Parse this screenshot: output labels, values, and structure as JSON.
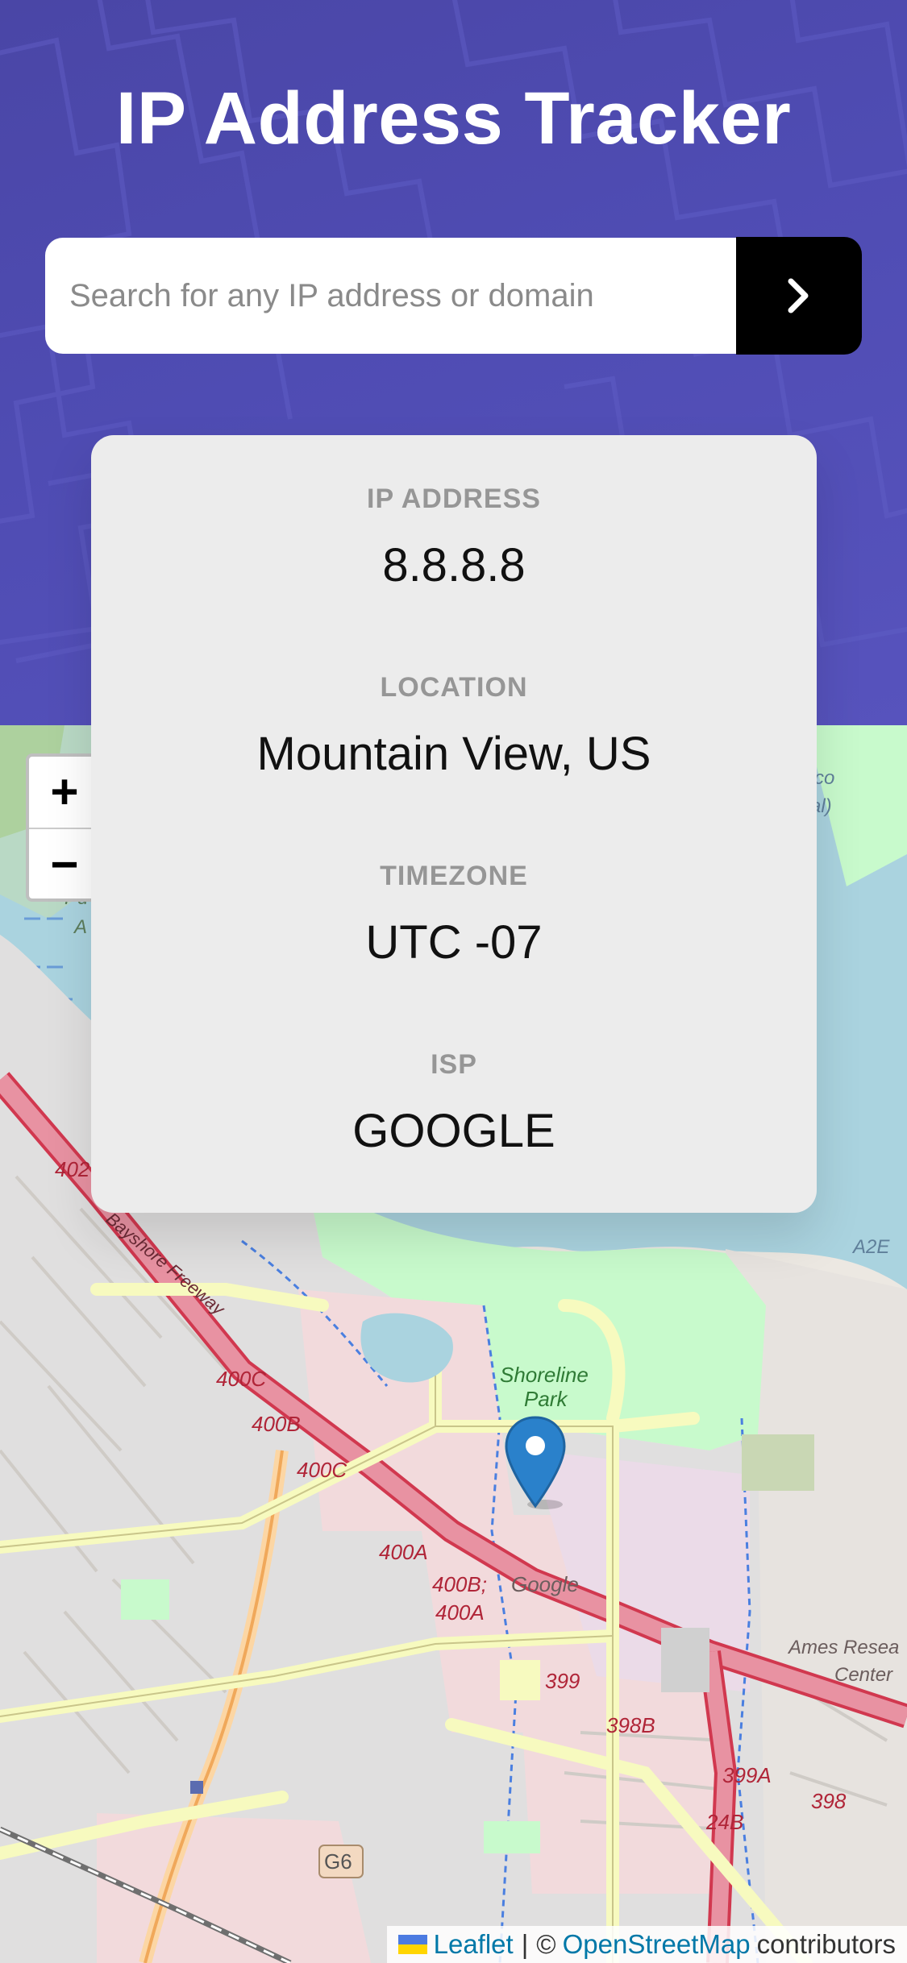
{
  "header": {
    "title": "IP Address Tracker"
  },
  "search": {
    "placeholder": "Search for any IP address or domain",
    "button_icon": "chevron-right-icon"
  },
  "info": {
    "ip_label": "IP ADDRESS",
    "ip_value": "8.8.8.8",
    "location_label": "LOCATION",
    "location_value": "Mountain View, US",
    "timezone_label": "TIMEZONE",
    "timezone_value": "UTC -07",
    "isp_label": "ISP",
    "isp_value": "GOOGLE"
  },
  "map": {
    "zoom_in": "+",
    "zoom_out": "−",
    "marker_icon": "map-pin-icon",
    "labels": {
      "park": "Shoreline",
      "park2": "Park",
      "google": "Google",
      "ames": "Ames Resea",
      "ames2": "Center",
      "exit_402": "402",
      "exit_400c_a": "400C",
      "exit_400b_a": "400B",
      "exit_400c_b": "400C",
      "exit_400a": "400A",
      "exit_400b_b": "400B;",
      "exit_400a_b": "400A",
      "exit_399": "399",
      "exit_398b": "398B",
      "exit_399a": "399A",
      "exit_398": "398",
      "exit_24b": "24B",
      "g6": "G6",
      "a2e": "A2E",
      "freeway": "Bayshore Freeway",
      "co": "co",
      "al": "al)",
      "pu": "Pu",
      "a": "A"
    },
    "attribution": {
      "leaflet": "Leaflet",
      "separator": "|",
      "copyright": "©",
      "osm": "OpenStreetMap",
      "contributors": "contributors"
    }
  },
  "colors": {
    "header_bg": "#4f4cb3",
    "button_bg": "#000000",
    "card_bg": "#ececec",
    "water": "#aad3df",
    "park": "#c8facc",
    "highway": "#e892a2",
    "road": "#f7fabf",
    "marker": "#2a81cb"
  }
}
